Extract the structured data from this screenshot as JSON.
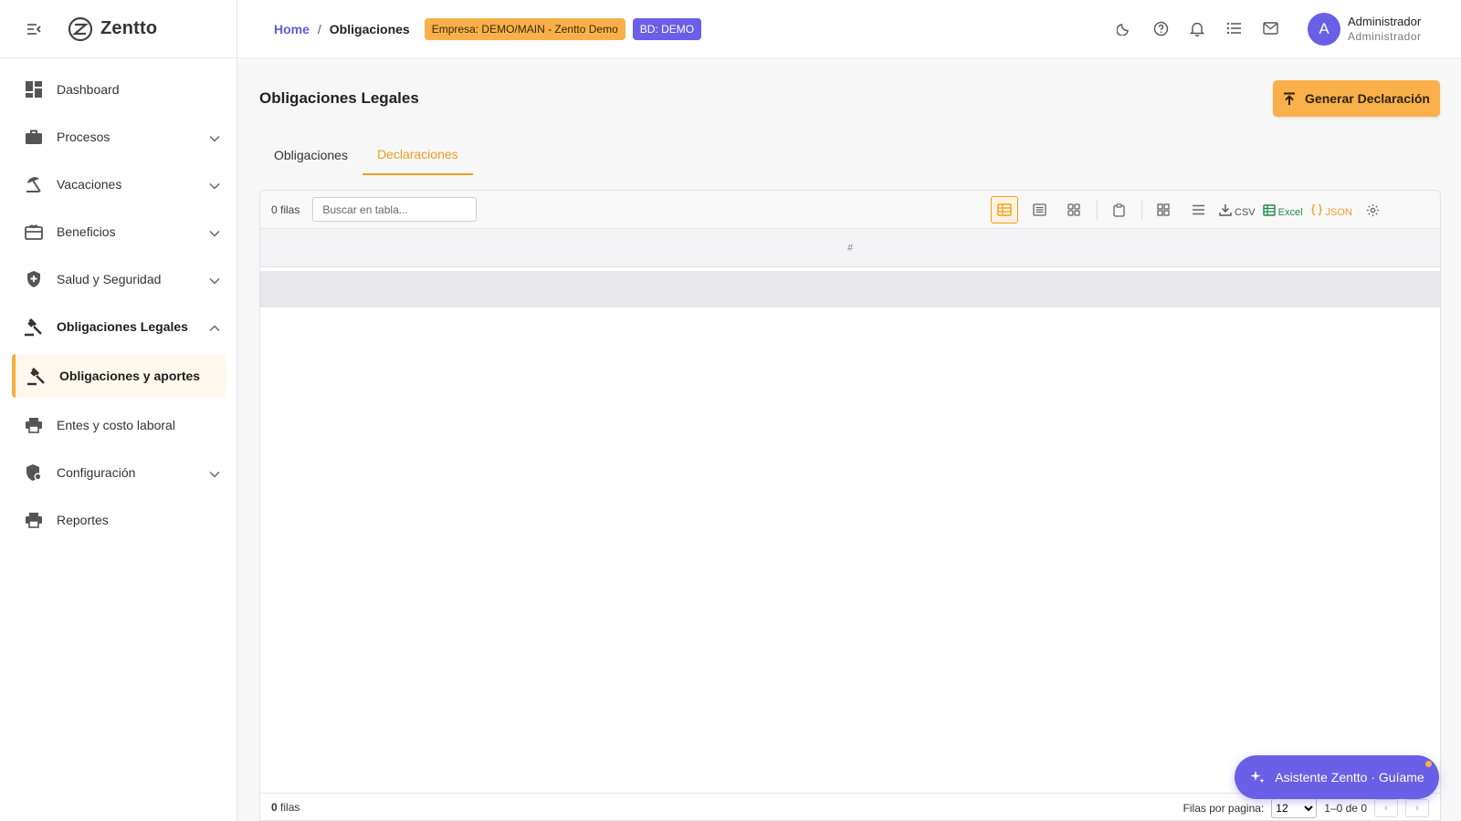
{
  "app": {
    "name": "Zentto"
  },
  "sidebar": {
    "items": [
      {
        "label": "Dashboard",
        "icon": "dashboard-icon",
        "chevron": ""
      },
      {
        "label": "Procesos",
        "icon": "briefcase-icon",
        "chevron": "down"
      },
      {
        "label": "Vacaciones",
        "icon": "beach-icon",
        "chevron": "down"
      },
      {
        "label": "Beneficios",
        "icon": "gift-card-icon",
        "chevron": "down"
      },
      {
        "label": "Salud y Seguridad",
        "icon": "shield-icon",
        "chevron": "down"
      },
      {
        "label": "Obligaciones Legales",
        "icon": "gavel-icon",
        "chevron": "up"
      },
      {
        "label": "Obligaciones y aportes",
        "icon": "gavel-icon",
        "chevron": ""
      },
      {
        "label": "Entes y costo laboral",
        "icon": "printer-icon",
        "chevron": ""
      },
      {
        "label": "Configuración",
        "icon": "admin-shield-icon",
        "chevron": "down"
      },
      {
        "label": "Reportes",
        "icon": "printer-icon",
        "chevron": ""
      }
    ]
  },
  "topbar": {
    "breadcrumb": {
      "home": "Home",
      "separator": "/",
      "current": "Obligaciones"
    },
    "empresa_badge": "Empresa: DEMO/MAIN - Zentto Demo",
    "bd_badge": "BD: DEMO",
    "user": {
      "initial": "A",
      "name": "Administrador",
      "role": "Administrador"
    }
  },
  "page": {
    "title": "Obligaciones Legales",
    "primary_button": "Generar Declaración",
    "tabs": [
      {
        "label": "Obligaciones",
        "active": false
      },
      {
        "label": "Declaraciones",
        "active": true
      }
    ]
  },
  "grid": {
    "rows_label": "0 filas",
    "search_placeholder": "Buscar en tabla...",
    "export_csv": "CSV",
    "export_excel": "Excel",
    "export_json": "JSON",
    "column_header": "#",
    "footer_count": "0",
    "footer_count_suffix": "filas",
    "rows_per_page_label": "Filas por pagina:",
    "rows_per_page": "12",
    "rows_per_page_options": [
      "12"
    ],
    "range": "1–0 de 0",
    "prev": "‹",
    "next": "›"
  },
  "assistant": {
    "label": "Asistente Zentto · Guíame"
  },
  "colors": {
    "accent": "#f9b04a",
    "primary": "#6a5fe6",
    "link": "#5a5fd8",
    "excel": "#1f8a4c"
  }
}
